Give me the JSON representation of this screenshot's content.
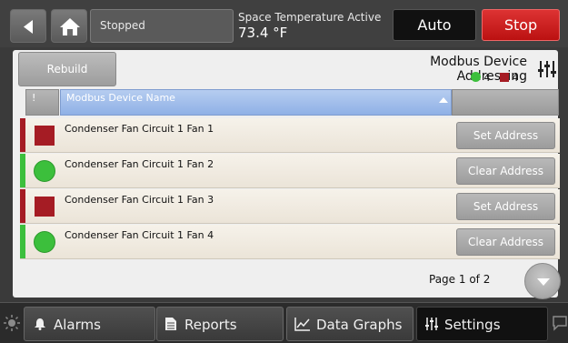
{
  "header": {
    "status": "Stopped",
    "temp_label": "Space Temperature Active",
    "temp_value": "73.4 °F",
    "auto_label": "Auto",
    "stop_label": "Stop"
  },
  "panel": {
    "rebuild_label": "Rebuild",
    "title": "Modbus Device Addressing",
    "count_ok": "4",
    "count_fault": "4"
  },
  "table": {
    "col_status": "!",
    "col_name": "Modbus Device Name",
    "rows": [
      {
        "name": "Condenser Fan Circuit 1 Fan 1",
        "state": "fault",
        "action": "Set Address"
      },
      {
        "name": "Condenser Fan Circuit 1 Fan 2",
        "state": "ok",
        "action": "Clear Address"
      },
      {
        "name": "Condenser Fan Circuit 1 Fan 3",
        "state": "fault",
        "action": "Set Address"
      },
      {
        "name": "Condenser Fan Circuit 1 Fan 4",
        "state": "ok",
        "action": "Clear Address"
      }
    ],
    "page_label": "Page 1 of 2"
  },
  "nav": {
    "alarms": "Alarms",
    "reports": "Reports",
    "data_graphs": "Data Graphs",
    "settings": "Settings"
  },
  "colors": {
    "fault": "#a51c24",
    "ok": "#3cbf3c",
    "stop": "#c62020",
    "header_blue": "#8fb0e6"
  }
}
